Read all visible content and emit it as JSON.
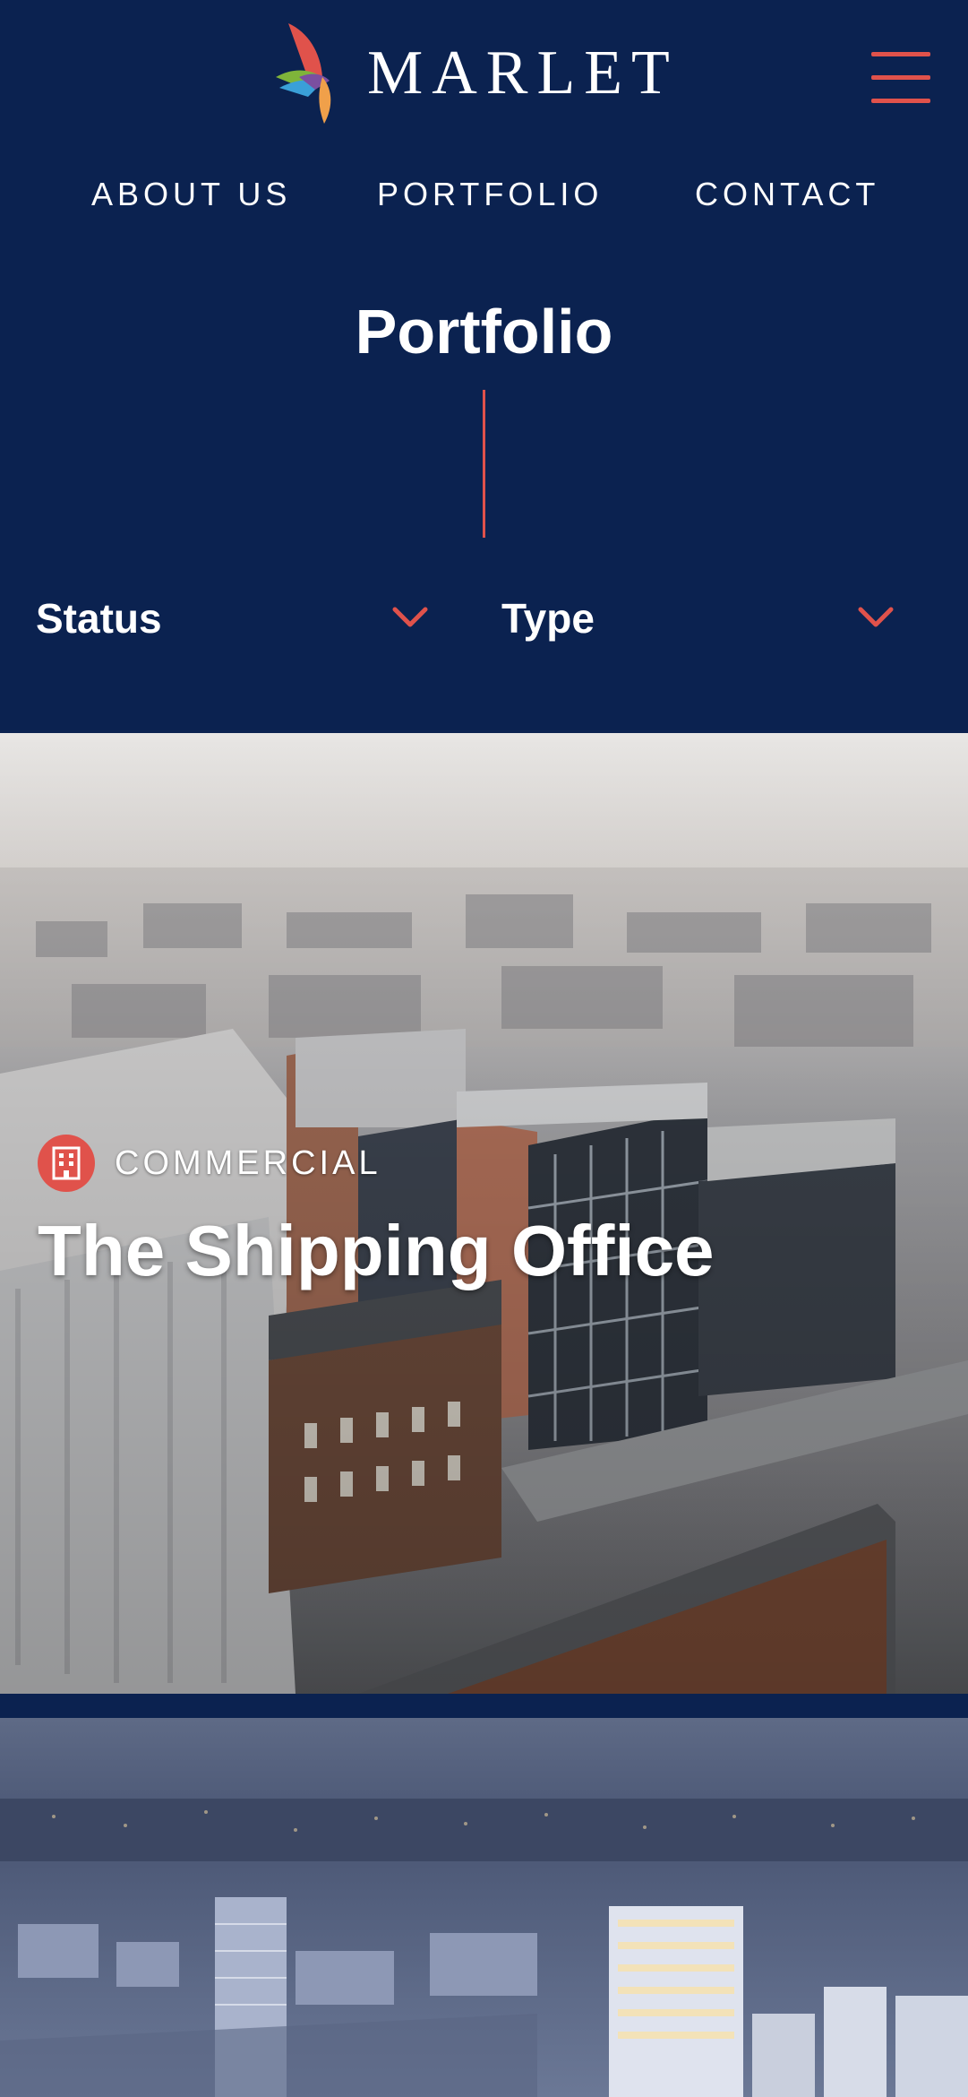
{
  "brand": {
    "name": "MARLET",
    "logo_icon": "marlet-bird-logo",
    "colors": {
      "navy": "#0b2250",
      "accent": "#e0524b",
      "white": "#ffffff"
    }
  },
  "header": {
    "menu_icon": "hamburger-menu-icon",
    "nav": [
      {
        "label": "ABOUT US"
      },
      {
        "label": "PORTFOLIO"
      },
      {
        "label": "CONTACT"
      }
    ]
  },
  "page": {
    "title": "Portfolio"
  },
  "filters": [
    {
      "label": "Status",
      "icon": "chevron-down-icon"
    },
    {
      "label": "Type",
      "icon": "chevron-down-icon"
    }
  ],
  "projects": [
    {
      "category": "COMMERCIAL",
      "category_icon": "office-building-icon",
      "title": "The Shipping Office"
    }
  ]
}
